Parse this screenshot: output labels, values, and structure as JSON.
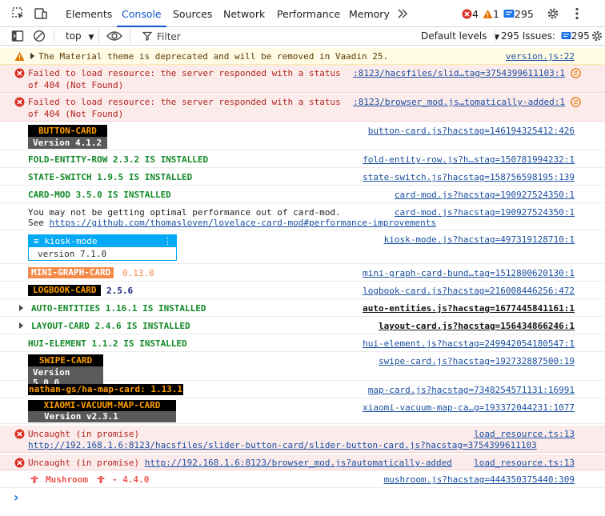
{
  "tabs": [
    "Elements",
    "Console",
    "Sources",
    "Network",
    "Performance",
    "Memory"
  ],
  "active_tab": "Console",
  "counts": {
    "errors": "4",
    "warnings": "1",
    "issues": "295"
  },
  "filterbar": {
    "context": "top",
    "filter_placeholder": "Filter",
    "levels": "Default levels",
    "issues_label": "295 Issues:",
    "issues_count": "295"
  },
  "messages": {
    "m0": {
      "text": "The Material theme is deprecated and will be removed in Vaadin 25.",
      "source": "version.js:22"
    },
    "m1": {
      "line1": "Failed to load resource: the server responded with a status",
      "line2": "of 404 (Not Found)",
      "source": ":8123/hacsfiles/slid…tag=3754399611103:1"
    },
    "m2": {
      "line1": "Failed to load resource: the server responded with a status",
      "line2": "of 404 (Not Found)",
      "source": ":8123/browser_mod.js…tomatically-added:1"
    },
    "m3": {
      "badge": "BUTTON-CARD",
      "version": "Version 4.1.2",
      "source": "button-card.js?hacstag=146194325412:426"
    },
    "m4": {
      "text": "FOLD-ENTITY-ROW 2.3.2 IS INSTALLED",
      "source": "fold-entity-row.js?h…stag=150781994232:1"
    },
    "m5": {
      "text": "STATE-SWITCH 1.9.5 IS INSTALLED",
      "source": "state-switch.js?hacstag=158756598195:139"
    },
    "m6": {
      "text": "CARD-MOD 3.5.0 IS INSTALLED",
      "source": "card-mod.js?hacstag=190927524350:1"
    },
    "m7": {
      "line1": "You may not be getting optimal performance out of card-mod.",
      "line2_prefix": "See ",
      "line2_link": "https://github.com/thomasloven/lovelace-card-mod#performance-improvements",
      "source": "card-mod.js?hacstag=190927524350:1"
    },
    "m8": {
      "title": "≡ kiosk-mode",
      "version": "version 7.1.0",
      "source": "kiosk-mode.js?hacstag=497319128710:1"
    },
    "m9": {
      "badge": "MINI-GRAPH-CARD",
      "version": "0.13.0",
      "source": "mini-graph-card-bund…tag=1512800620130:1"
    },
    "m10": {
      "badge": "LOGBOOK-CARD",
      "version": "2.5.6",
      "source": "logbook-card.js?hacstag=216008446256:472"
    },
    "m11": {
      "text": "AUTO-ENTITIES 1.16.1 IS INSTALLED",
      "source": "auto-entities.js?hacstag=1677445841161:1"
    },
    "m12": {
      "text": "LAYOUT-CARD 2.4.6 IS INSTALLED",
      "source": "layout-card.js?hacstag=156434866246:1"
    },
    "m13": {
      "text": "HUI-ELEMENT 1.1.2 IS INSTALLED",
      "source": "hui-element.js?hacstag=249942054180547:1"
    },
    "m14": {
      "badge": "SWIPE-CARD",
      "version": "Version 5.0.0",
      "source": "swipe-card.js?hacstag=192732887500:19"
    },
    "m15": {
      "badge": "nathan-gs/ha-map-card: 1.13.1",
      "source": "map-card.js?hacstag=7348254571131:16991"
    },
    "m16": {
      "badge": "XIAOMI-VACUUM-MAP-CARD",
      "version": "Version v2.3.1",
      "source": "xiaomi-vacuum-map-ca…g=193372044231:1077"
    },
    "m17": {
      "line1": "Uncaught (in promise)",
      "line2": "http://192.168.1.6:8123/hacsfiles/slider-button-card/slider-button-card.js?hacstag=3754399611103",
      "source": "load_resource.ts:13"
    },
    "m18": {
      "prefix": "Uncaught (in promise) ",
      "link": "http://192.168.1.6:8123/browser_mod.js?automatically-added",
      "source": "load_resource.ts:13"
    },
    "m19": {
      "text": "Mushroom",
      "version": "- 4.4.0",
      "source": "mushroom.js?hacstag=444350375440:309"
    },
    "prompt": "›"
  },
  "colors": {
    "accent": "#0b57d0",
    "error": "#d93025",
    "warning": "#e37400",
    "installed_green": "#138a28",
    "badge_orange": "#ff9d00",
    "mini_graph": "#f38b4a",
    "kiosk_blue": "#03a9f4",
    "mushroom": "#ef5350"
  },
  "icons": [
    "inspect-icon",
    "device-toolbar-icon",
    "more-tabs-icon",
    "error-icon",
    "warning-icon",
    "issues-icon",
    "settings-icon",
    "more-menu-icon",
    "sidebar-icon",
    "clear-icon",
    "eye-icon",
    "filter-icon",
    "mushroom-icon"
  ]
}
